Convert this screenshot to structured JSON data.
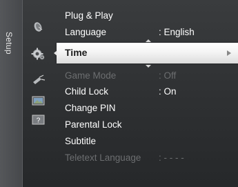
{
  "sidebar": {
    "tab_label": "Setup"
  },
  "icons": [
    "satellite-dish-icon",
    "setup-gear-icon",
    "input-antenna-icon",
    "picture-icon",
    "help-icon"
  ],
  "menu": {
    "items": [
      {
        "label": "Plug & Play",
        "value": "",
        "enabled": true
      },
      {
        "label": "Language",
        "value": ": English",
        "enabled": true
      },
      {
        "label": "Time",
        "value": "",
        "enabled": true,
        "selected": true
      },
      {
        "label": "Game Mode",
        "value": ": Off",
        "enabled": false
      },
      {
        "label": "Child Lock",
        "value": ": On",
        "enabled": true
      },
      {
        "label": "Change PIN",
        "value": "",
        "enabled": true
      },
      {
        "label": "Parental Lock",
        "value": "",
        "enabled": true
      },
      {
        "label": "Subtitle",
        "value": "",
        "enabled": true
      },
      {
        "label": "Teletext Language",
        "value": ": - - - -",
        "enabled": false
      }
    ]
  },
  "colors": {
    "background": "#2e3032",
    "text": "#ffffff",
    "disabled_text": "#6c6e70",
    "highlight": "#f4f4f4"
  }
}
